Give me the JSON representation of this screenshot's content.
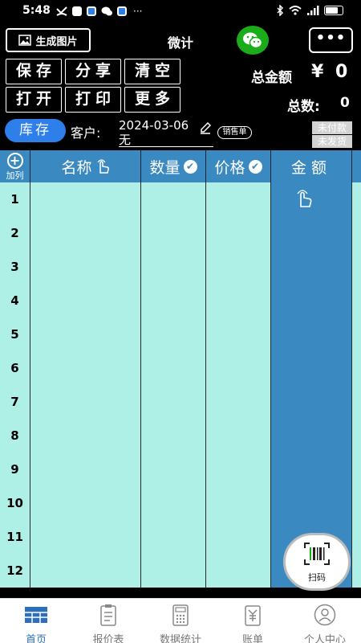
{
  "status_bar": {
    "time": "5:48",
    "battery_level": 0.8
  },
  "header": {
    "generate_image_label": "生成图片",
    "title": "微计",
    "more_label": "•••"
  },
  "toolbar": {
    "save": "保存",
    "share": "分享",
    "clear": "清空",
    "open": "打开",
    "print": "打印",
    "more": "更多"
  },
  "totals": {
    "amount_label": "总金额",
    "currency": "¥",
    "amount_value": "0",
    "count_label": "总数:",
    "count_value": "0"
  },
  "order": {
    "inventory_label": "库存",
    "customer_label": "客户:",
    "date": "2024-03-06",
    "customer_name": "无",
    "order_type": "销售单",
    "payment_status": "未付款",
    "shipping_status": "未发货"
  },
  "table": {
    "add_column_label": "加列",
    "columns": [
      "名称",
      "数量",
      "价格",
      "金额"
    ],
    "rows": [
      "1",
      "2",
      "3",
      "4",
      "5",
      "6",
      "7",
      "8",
      "9",
      "10",
      "11",
      "12"
    ]
  },
  "scan_button": {
    "label": "扫码"
  },
  "tab_bar": {
    "active": "首页",
    "tabs": [
      "首页",
      "报价表",
      "数据统计",
      "账单",
      "个人中心"
    ]
  },
  "colors": {
    "header_blue": "#3a89c0",
    "row_cyan": "#aff0e6",
    "accent_blue": "#2e7fea",
    "wechat_green": "#1aad19",
    "active_tab": "#2b6fbe"
  }
}
